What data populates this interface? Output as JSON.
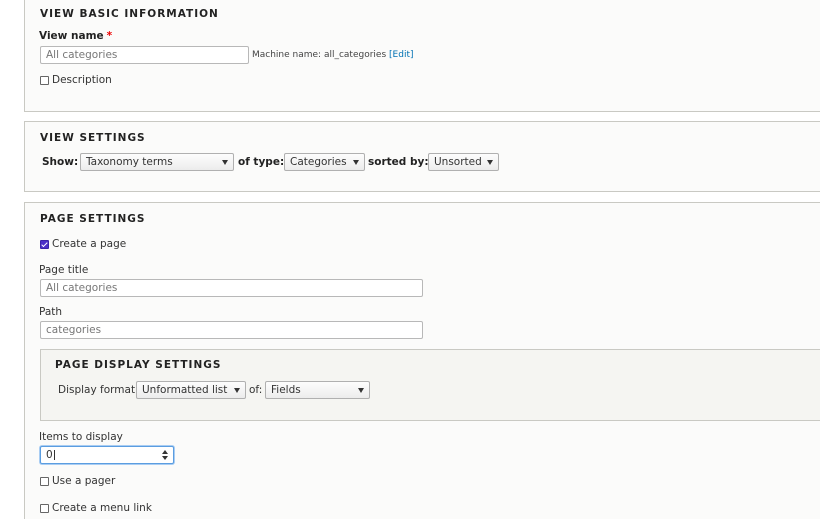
{
  "basic_info": {
    "legend": "VIEW BASIC INFORMATION",
    "view_name_label": "View name",
    "required_mark": "*",
    "view_name_value": "All categories",
    "machine_name_prefix": "Machine name: all_categories",
    "machine_name_edit": "[Edit]",
    "description_label": "Description"
  },
  "view_settings": {
    "legend": "VIEW SETTINGS",
    "show_label": "Show:",
    "show_value": "Taxonomy terms",
    "of_type_label": "of type:",
    "of_type_value": "Categories",
    "sorted_by_label": "sorted by:",
    "sorted_by_value": "Unsorted"
  },
  "page_settings": {
    "legend": "PAGE SETTINGS",
    "create_page_label": "Create a page",
    "create_page_checked": true,
    "page_title_label": "Page title",
    "page_title_value": "All categories",
    "path_label": "Path",
    "path_value": "categories",
    "display": {
      "legend": "PAGE DISPLAY SETTINGS",
      "format_label": "Display format:",
      "format_value": "Unformatted list",
      "of_label": "of:",
      "of_value": "Fields"
    },
    "items_label": "Items to display",
    "items_value": "0",
    "use_pager_label": "Use a pager",
    "menu_link_label": "Create a menu link"
  },
  "colors": {
    "accent_link": "#0071b3",
    "checkbox_checked": "#4b30c8",
    "focus_border": "#5b9de0",
    "required": "#ee0000"
  }
}
